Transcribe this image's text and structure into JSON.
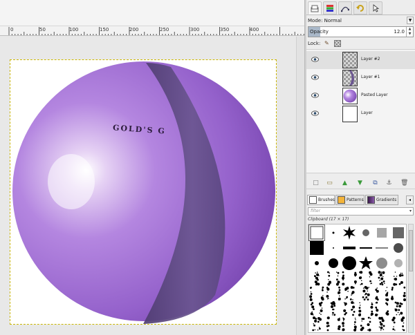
{
  "canvas": {
    "ruler_labels": [
      "0",
      "50",
      "100",
      "150",
      "200",
      "250",
      "300",
      "350",
      "400"
    ],
    "image_text": "GOLD'S G"
  },
  "dock": {
    "tab_icons": [
      "layers-icon",
      "channels-icon",
      "paths-icon",
      "undo-icon",
      "pointer-icon"
    ],
    "mode_label": "Mode: Normal",
    "opacity_label": "Opacity",
    "opacity_value": "12.0",
    "lock_label": "Lock:",
    "layers": [
      {
        "name": "Layer #2",
        "thumb": "checker",
        "selected": true
      },
      {
        "name": "Layer #1",
        "thumb": "purple-crescent",
        "selected": false
      },
      {
        "name": "Pasted Layer",
        "thumb": "purple-ball",
        "selected": false
      },
      {
        "name": "Layer",
        "thumb": "white",
        "selected": false
      }
    ],
    "layer_action_icons": [
      "new-layer-icon",
      "layer-group-icon",
      "raise-layer-icon",
      "lower-layer-icon",
      "duplicate-layer-icon",
      "anchor-icon",
      "delete-layer-icon"
    ]
  },
  "brushes": {
    "tabs": [
      {
        "label": "Brushes",
        "swatch": "#ffffff"
      },
      {
        "label": "Patterns",
        "swatch": "#f4b43a"
      },
      {
        "label": "Gradients",
        "swatch": "#6a3a7a"
      }
    ],
    "filter_placeholder": "filter",
    "current_brush": "Clipboard (17 × 17)"
  },
  "colors": {
    "ball_purple": "#9b6bd0",
    "ball_dark": "#6a3a9c",
    "crescent": "#5a4a78",
    "selection_dash": "#c8b400"
  }
}
